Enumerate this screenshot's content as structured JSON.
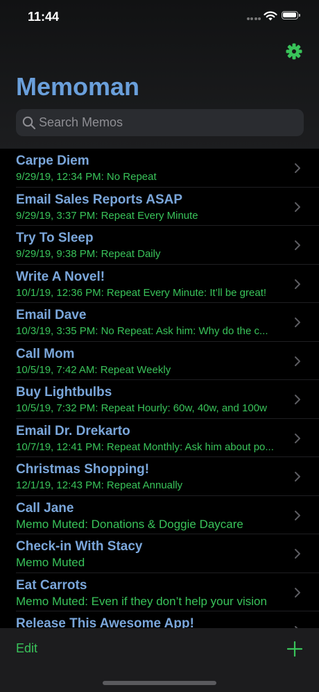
{
  "status_bar": {
    "time": "11:44"
  },
  "header": {
    "title": "Memoman",
    "settings_icon": "gear-icon",
    "accent_color": "#39c35a",
    "title_color": "#6a9fdb"
  },
  "search": {
    "placeholder": "Search Memos",
    "value": ""
  },
  "memos": [
    {
      "title": "Carpe Diem",
      "subtitle": "9/29/19, 12:34 PM: No Repeat"
    },
    {
      "title": "Email Sales Reports ASAP",
      "subtitle": "9/29/19, 3:37 PM: Repeat Every Minute"
    },
    {
      "title": "Try To Sleep",
      "subtitle": "9/29/19, 9:38 PM: Repeat Daily"
    },
    {
      "title": "Write A Novel!",
      "subtitle": "10/1/19, 12:36 PM: Repeat Every Minute: It’ll be great!"
    },
    {
      "title": "Email Dave",
      "subtitle": "10/3/19, 3:35 PM: No Repeat: Ask him: Why do the c..."
    },
    {
      "title": "Call Mom",
      "subtitle": "10/5/19, 7:42 AM: Repeat Weekly"
    },
    {
      "title": "Buy Lightbulbs",
      "subtitle": "10/5/19, 7:32 PM: Repeat Hourly: 60w, 40w, and 100w"
    },
    {
      "title": "Email Dr. Drekarto",
      "subtitle": "10/7/19, 12:41 PM: Repeat Monthly: Ask him about po..."
    },
    {
      "title": "Christmas Shopping!",
      "subtitle": "12/1/19, 12:43 PM: Repeat Annually"
    },
    {
      "title": "Call Jane",
      "subtitle": "Memo Muted: Donations & Doggie Daycare",
      "muted": true
    },
    {
      "title": "Check-in With Stacy",
      "subtitle": "Memo Muted",
      "muted": true
    },
    {
      "title": "Eat Carrots",
      "subtitle": "Memo Muted: Even if they don’t help your vision",
      "muted": true
    },
    {
      "title": "Release This Awesome App!",
      "subtitle": ""
    }
  ],
  "toolbar": {
    "edit_label": "Edit",
    "add_icon": "plus-icon"
  }
}
